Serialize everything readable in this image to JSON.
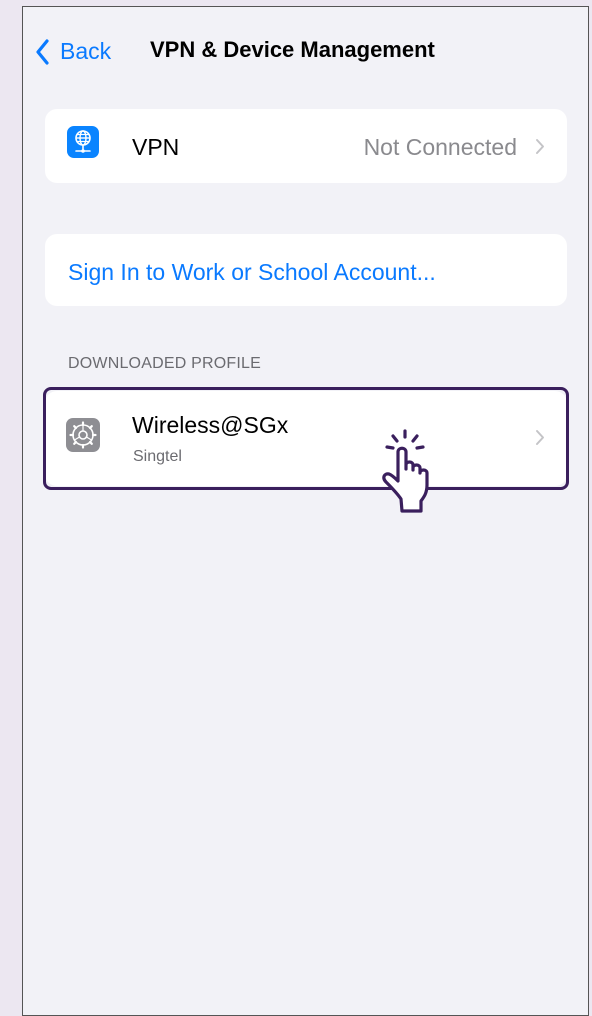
{
  "nav": {
    "back_label": "Back",
    "title": "VPN & Device Management"
  },
  "vpn": {
    "icon": "globe-network-icon",
    "label": "VPN",
    "status": "Not Connected"
  },
  "account": {
    "sign_in_label": "Sign In to Work or School Account..."
  },
  "profiles": {
    "section_header": "DOWNLOADED PROFILE",
    "items": [
      {
        "icon": "settings-gear-icon",
        "name": "Wireless@SGx",
        "subtitle": "Singtel"
      }
    ]
  },
  "colors": {
    "accent": "#0A7AFF",
    "highlight": "#3A1F5D",
    "background": "#F2F2F7"
  }
}
